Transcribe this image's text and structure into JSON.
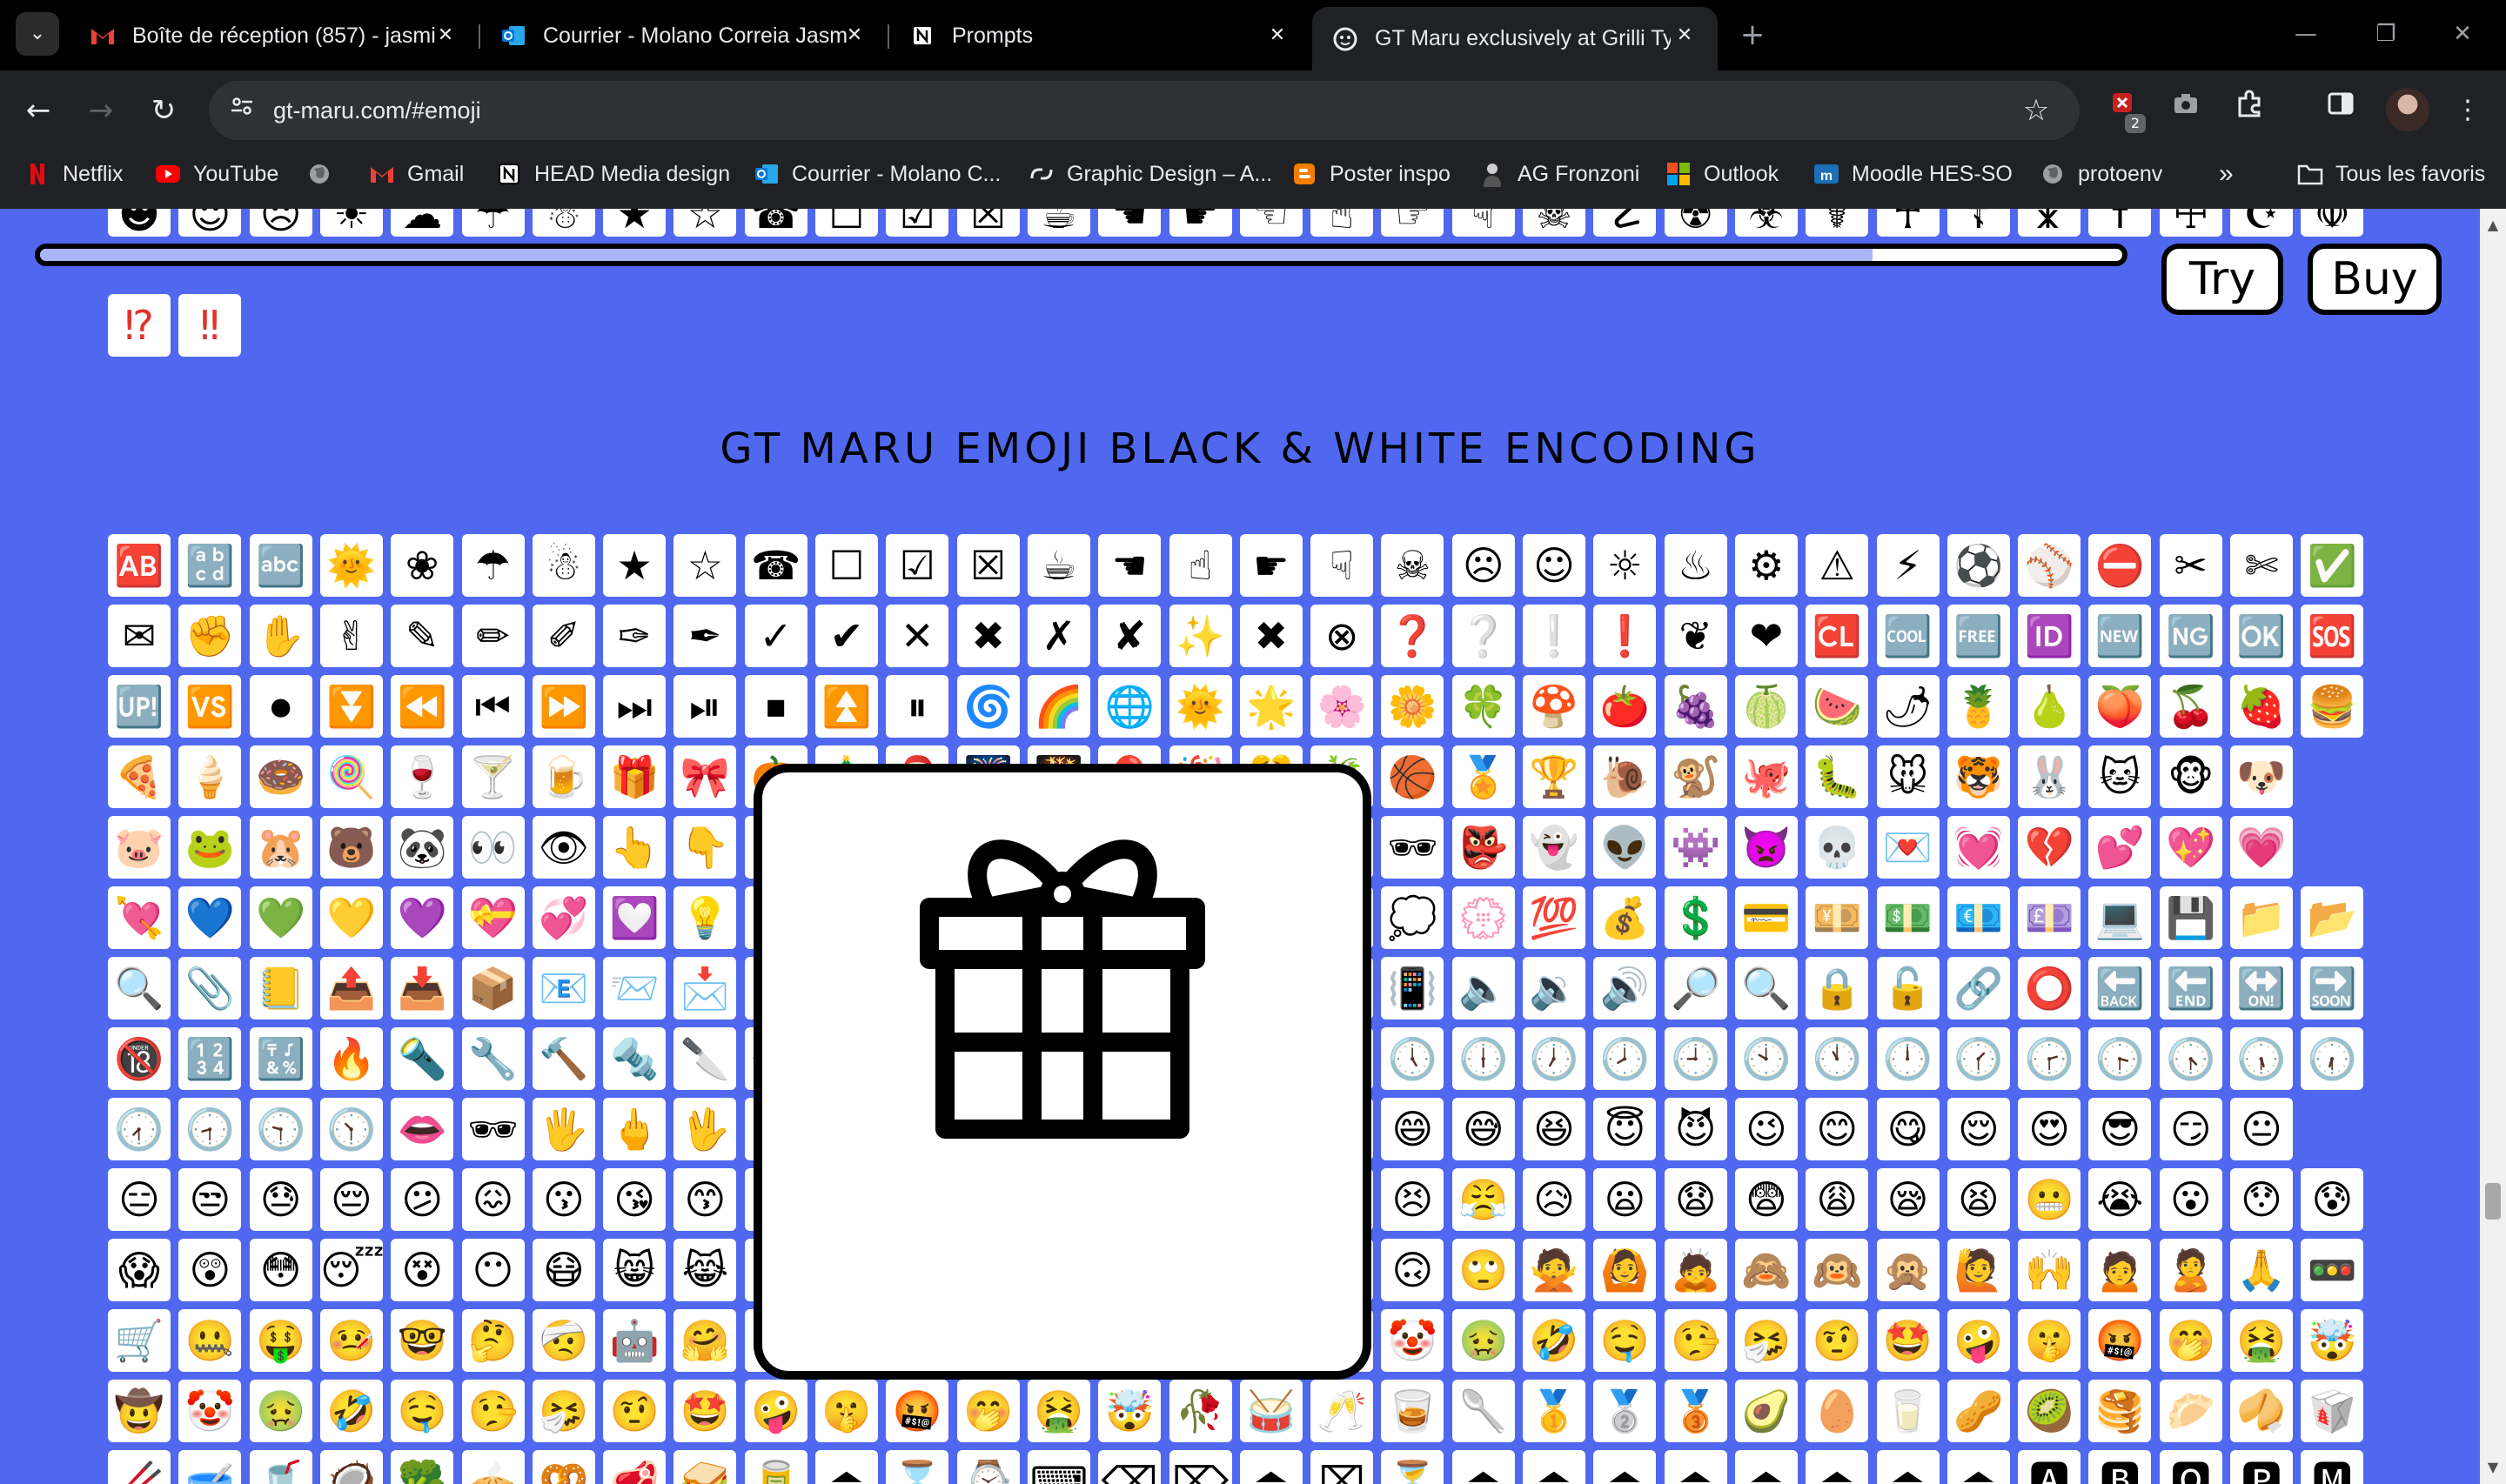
{
  "browser": {
    "tabs": [
      {
        "title": "Boîte de réception (857) - jasmi",
        "close": "✕",
        "favicon": "gmail-icon"
      },
      {
        "title": "Courrier - Molano Correia Jasm",
        "close": "✕",
        "favicon": "outlook-icon"
      },
      {
        "title": "Prompts",
        "close": "✕",
        "favicon": "notion-icon"
      },
      {
        "title": "GT Maru exclusively at Grilli Typ",
        "close": "✕",
        "favicon": "grilli-type-icon",
        "active": true
      }
    ],
    "tab_list_glyph": "⌄",
    "new_tab_glyph": "+",
    "window_controls": {
      "minimize": "—",
      "restore": "❐",
      "close": "✕"
    },
    "nav": {
      "back": "←",
      "forward": "→",
      "reload": "↻"
    },
    "url": "gt-maru.com/#emoji",
    "bookmark_star": "☆",
    "extensions_badge": "2",
    "menu_glyph": "⋮",
    "bookmarks": [
      {
        "label": "Netflix",
        "icon": "netflix-icon"
      },
      {
        "label": "YouTube",
        "icon": "youtube-icon"
      },
      {
        "label": "",
        "icon": "globe-icon"
      },
      {
        "label": "Gmail",
        "icon": "gmail-icon"
      },
      {
        "label": "HEAD Media design",
        "icon": "notion-icon"
      },
      {
        "label": "Courrier - Molano C...",
        "icon": "outlook-icon"
      },
      {
        "label": "Graphic Design – A...",
        "icon": "link-icon"
      },
      {
        "label": "Poster inspo",
        "icon": "blogger-icon"
      },
      {
        "label": "AG Fronzoni",
        "icon": "person-icon"
      },
      {
        "label": "Outlook",
        "icon": "microsoft-icon"
      },
      {
        "label": "Moodle HES-SO",
        "icon": "moodle-icon"
      },
      {
        "label": "protoenv",
        "icon": "globe-icon"
      }
    ],
    "bookmarks_overflow": "»",
    "all_bookmarks": "Tous les favoris",
    "brand_colors": {
      "netflix": "#e50914",
      "youtube": "#ff0000",
      "gmail": "#ea4335",
      "outlook": "#0078d4",
      "blogger": "#f57d00"
    }
  },
  "page": {
    "background": "#5068ef",
    "try_label": "Try",
    "buy_label": "Buy",
    "section_heading": "GT MARU EMOJI BLACK & WHITE ENCODING",
    "strip_progress": 0.88,
    "strip_row_glyphs": "☻☺☹☀☁☂☃★☆☎☐☑☒☕☚☛☜☝☞☟☠☡☢☣☤☥☦☧☨☩☪☫☬☭☮☯☰☱☲☳☴☵☶☷☸☹☺☻☼☽☾☿♀",
    "color_tail_glyphs": [
      "⁉",
      "‼"
    ],
    "emoji_rows": [
      "🆎🔡🔤🌞❀☂☃★☆☎☐☑☒☕☚☝☛☟☠☹☺☼♨⚙⚠⚡⚽⚾⛔✂✄✅",
      "✉✊✋✌✎✏✐✑✒✓✔✕✖✗✘✨✖⊗❓❔❕❗❦❤🆑🆒🆓🆔🆕🆖🆗🆘",
      "🆙🆚⏺⏬⏪⏮⏩⏭⏯⏹⏫⏸🌀🌈🌐🌞🌟🌸🌼🍀🍄🍅🍇🍈🍉🌶🍍🍐🍑🍒🍓🍔",
      "🍕🍦🍩🍭🍷🍸🍺🎁🎀🎃🎄🎅🎆🎇🎈🎉🎊🎋🏀🏅🏆🐌🐒🐙🐛🐭🐯🐰🐱🐵🐶",
      "🐷🐸🐹🐻🐼👀👁👆👇👈👉👊👋👌👍👎👏👐🕶👺👻👽👾👿💀💌💓💔💕💖💗",
      "💘💙💚💛💜💝💞💟💡💤💥💦💧💨💩💪💫💬💭💮💯💰💲💳💴💵💶💷💻💾📁📂📄📌",
      "🔍📎📒📤📥📦📧📨📩📪📫📬📭📮📯📰📱📲📳🔈🔉🔊🔎🔍🔒🔓🔗⭕🔙🔚🔛🔜🔝",
      "🔞🔢🔣🔥🔦🔧🔨🔩🔪🔫🔬🔭🔮🔯🕐🕑🕒🕓🕔🕕🕖🕗🕘🕙🕚🕛🕜🕝🕞🕟🕠🕡",
      "🕢🕣🕤🕥👄🕶🖐🖕🖖🗻🗼🗽🗾🗿😀😁😂😃😄😅😆😇😈😉😊😋😌😍😎😏😐",
      "😑😒😓😔😕😖😗😘😙😚😛😜😝😞😟😠😡😢😣😤😥😦😧😨😩😪😫😬😭😮😯😰",
      "😱😲😳😴😵😶😷😸😹😺😻😼😽😾😿🙀🙁🙂🙃🙄🙅🙆🙇🙈🙉🙊🙋🙌🙍🙎🙏🚥🚫🚾",
      "🛒🤐🤑🤒🤓🤔🤕🤖🤗🤘🤙🤚🤛🤜🤝🤞🤟🤠🤡🤢🤣🤤🤥🤧🤨🤩🤪🤫🤬🤭🤮🤯",
      "🤠🤡🤢🤣🤤🤥🤧🤨🤩🤪🤫🤬🤭🤮🤯🥀🥁🥂🥃🥄🥇🥈🥉🥑🥚🥛🥜🥝🥞🥟🥠🥡",
      "🥢🥣🥤🥥🥦🥧🥨🥩🥪🥫⏏⌛⌚⌨⌫⌦⏏⌧⏳⏏⏏⏏⏏⏏⏏⏏⏏🅰🅱🅾🅿🅼Ⓜ"
    ],
    "preview_glyph_name": "gift-icon"
  }
}
